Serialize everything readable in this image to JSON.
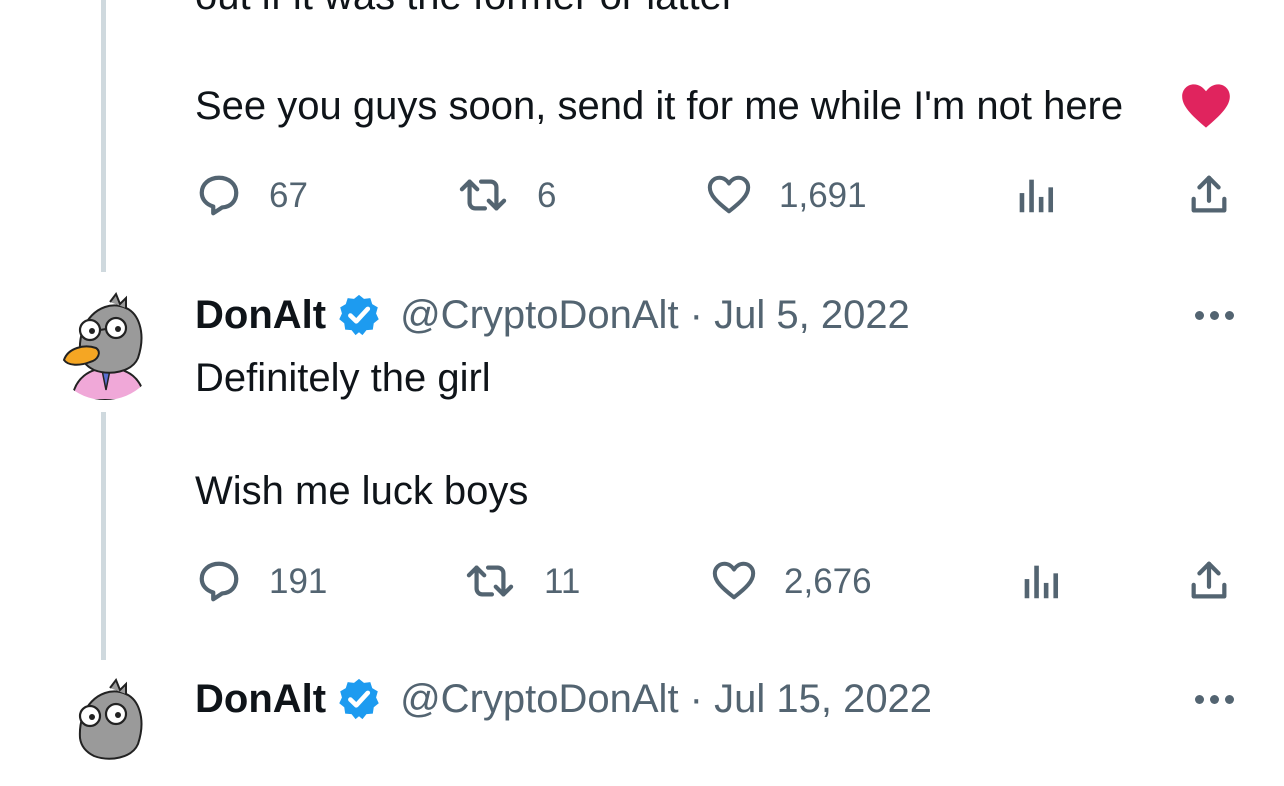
{
  "tweet_prev": {
    "partial_line": "out if it was the former or latter",
    "text": "See you guys soon, send it for me while I'm not here",
    "replies": "67",
    "retweets": "6",
    "likes": "1,691"
  },
  "tweet1": {
    "name": "DonAlt",
    "handle": "@CryptoDonAlt · Jul 5, 2022",
    "line1": "Definitely the girl",
    "line2": "Wish me luck boys",
    "replies": "191",
    "retweets": "11",
    "likes": "2,676"
  },
  "tweet2": {
    "name": "DonAlt",
    "handle": "@CryptoDonAlt · Jul 15, 2022"
  },
  "colors": {
    "text": "#0f1419",
    "muted": "#536471",
    "verified": "#1d9bf0",
    "heart": "#e0245e",
    "thread_line": "#cfd9de"
  },
  "icons": [
    "reply-icon",
    "retweet-icon",
    "like-icon",
    "views-icon",
    "share-icon",
    "verified-badge-icon",
    "more-icon"
  ]
}
